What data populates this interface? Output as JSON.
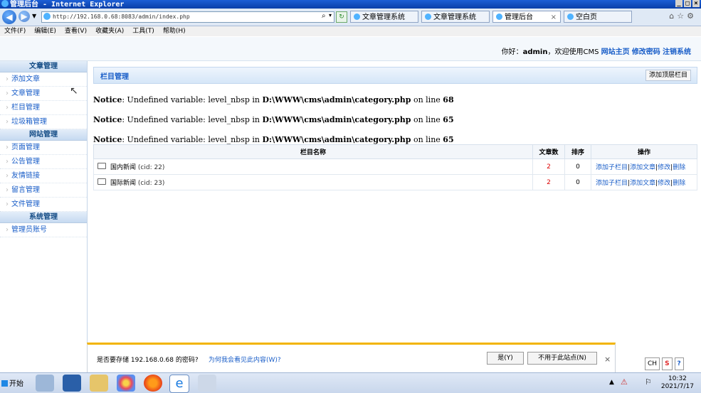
{
  "browser": {
    "window_title": "管理后台 - Internet Explorer",
    "address": "http://192.168.0.68:8083/admin/index.php",
    "tabs": [
      {
        "label": "文章管理系统",
        "active": false
      },
      {
        "label": "文章管理系统",
        "active": false
      },
      {
        "label": "管理后台",
        "active": true
      },
      {
        "label": "空白页",
        "active": false
      }
    ],
    "menu": [
      "文件(F)",
      "编辑(E)",
      "查看(V)",
      "收藏夹(A)",
      "工具(T)",
      "帮助(H)"
    ]
  },
  "header": {
    "greeting": "你好：",
    "username": "admin",
    "welcome_text": "，欢迎使用CMS",
    "links": [
      "网站主页",
      "修改密码",
      "注销系统"
    ]
  },
  "sidebar": {
    "sections": [
      {
        "title": "文章管理",
        "items": [
          "添加文章",
          "文章管理",
          "栏目管理",
          "垃圾箱管理"
        ]
      },
      {
        "title": "网站管理",
        "items": [
          "页面管理",
          "公告管理",
          "友情链接",
          "留言管理",
          "文件管理"
        ]
      },
      {
        "title": "系统管理",
        "items": [
          "管理员账号"
        ]
      }
    ]
  },
  "main": {
    "panel_title": "栏目管理",
    "add_top_button": "添加顶层栏目",
    "notices": [
      {
        "label": "Notice",
        "text": ": Undefined variable: level_nbsp in ",
        "path": "D:\\WWW\\cms\\admin\\category.php",
        "on": " on line ",
        "line": "68"
      },
      {
        "label": "Notice",
        "text": ": Undefined variable: level_nbsp in ",
        "path": "D:\\WWW\\cms\\admin\\category.php",
        "on": " on line ",
        "line": "65"
      },
      {
        "label": "Notice",
        "text": ": Undefined variable: level_nbsp in ",
        "path": "D:\\WWW\\cms\\admin\\category.php",
        "on": " on line ",
        "line": "65"
      }
    ],
    "table": {
      "headers": [
        "栏目名称",
        "文章数",
        "排序",
        "操作"
      ],
      "rows": [
        {
          "name": "国内新闻",
          "cid": "(cid: 22)",
          "count": "2",
          "order": "0"
        },
        {
          "name": "国际新闻",
          "cid": "(cid: 23)",
          "count": "2",
          "order": "0"
        }
      ],
      "actions": [
        "添加子栏目",
        "添加文章",
        "修改",
        "删除"
      ]
    }
  },
  "save_password_bar": {
    "question": "是否要存储 192.168.0.68 的密码?",
    "why_link": "为何我会看见此内容(W)?",
    "yes_button": "是(Y)",
    "never_button": "不用于此站点(N)",
    "close": "×"
  },
  "language_bar": {
    "lang": "CH"
  },
  "taskbar": {
    "start_label": "开始",
    "time": "10:32",
    "date": "2021/7/17"
  },
  "colors": {
    "accent": "#1a5ec8",
    "warning_bar": "#f2b400"
  }
}
